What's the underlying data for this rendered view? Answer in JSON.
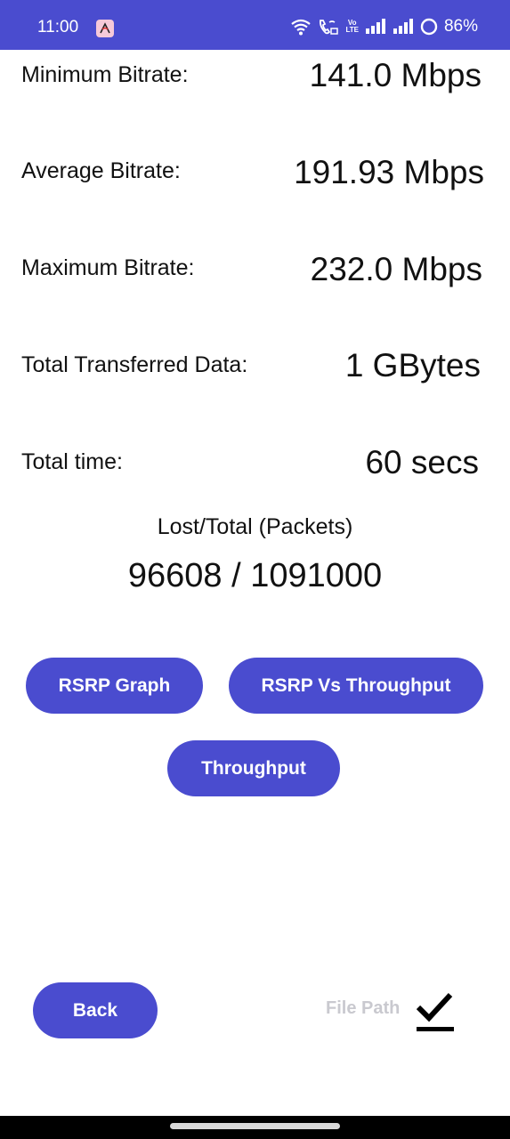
{
  "status_bar": {
    "time": "11:00",
    "battery": "86%",
    "volte_top": "Vo",
    "volte_bottom": "LTE",
    "icons": [
      "app-notification-icon",
      "wifi-icon",
      "wifi-calling-icon",
      "volte-icon",
      "signal-icon",
      "signal-icon",
      "battery-icon"
    ],
    "background": "#4a4ccf"
  },
  "stats": {
    "min_bitrate_label": "Minimum Bitrate:",
    "min_bitrate_value": "141.0 Mbps",
    "avg_bitrate_label": "Average Bitrate:",
    "avg_bitrate_value": "191.93 Mbps",
    "max_bitrate_label": "Maximum Bitrate:",
    "max_bitrate_value": "232.0 Mbps",
    "total_data_label": "Total Transferred Data:",
    "total_data_value": "1 GBytes",
    "total_time_label": "Total time:",
    "total_time_value": "60 secs"
  },
  "packets": {
    "label": "Lost/Total (Packets)",
    "value": "96608 / 1091000"
  },
  "buttons": {
    "rsrp_graph": "RSRP Graph",
    "rsrp_vs_throughput": "RSRP Vs Throughput",
    "throughput": "Throughput",
    "back": "Back"
  },
  "file_path": {
    "label": "File Path",
    "icon": "check-icon"
  },
  "colors": {
    "accent": "#4a4ccf",
    "disabled_text": "#c9c9cf"
  }
}
